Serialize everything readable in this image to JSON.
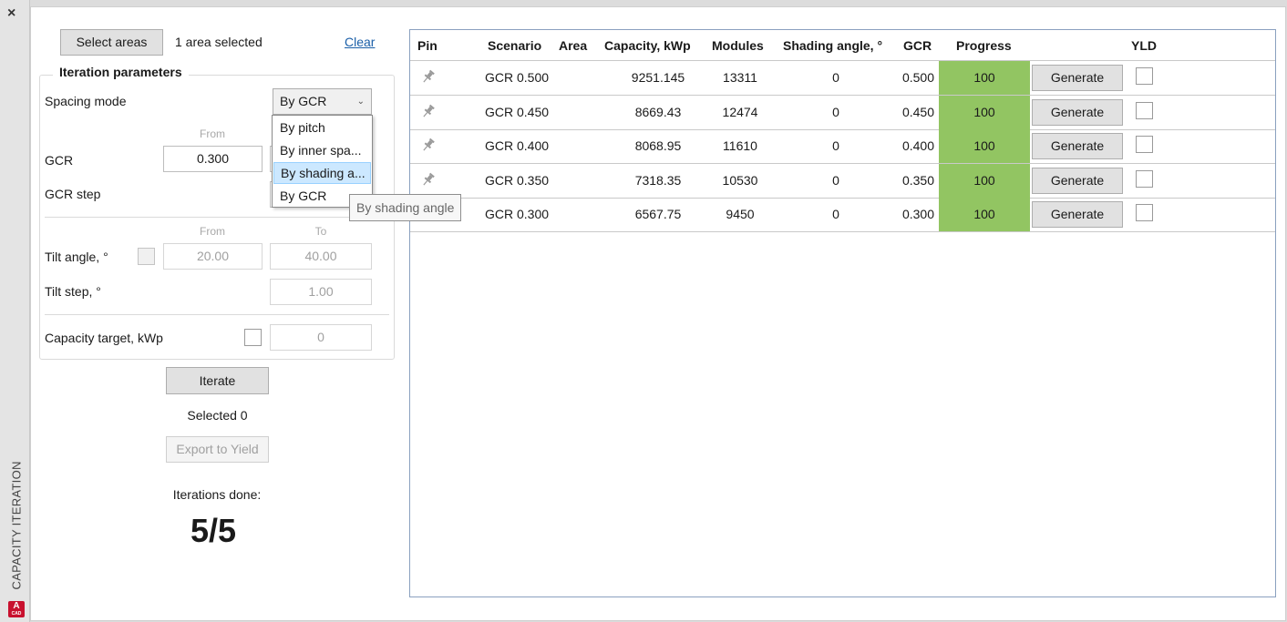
{
  "panel": {
    "side_title": "CAPACITY ITERATION",
    "close_glyph": "×",
    "app_logo_letter": "A",
    "app_logo_sub": "CAD"
  },
  "left": {
    "select_areas": "Select areas",
    "area_status": "1 area selected",
    "clear": "Clear",
    "group_title": "Iteration parameters",
    "spacing_mode_label": "Spacing mode",
    "spacing_mode_value": "By GCR",
    "dropdown_options": [
      "By pitch",
      "By inner spa...",
      "By shading a...",
      "By GCR"
    ],
    "dropdown_highlighted_index": 2,
    "tooltip": "By shading angle",
    "from_label": "From",
    "to_label": "To",
    "gcr_label": "GCR",
    "gcr_from": "0.300",
    "gcr_step_label": "GCR step",
    "tilt_label": "Tilt angle, °",
    "tilt_from": "20.00",
    "tilt_to": "40.00",
    "tilt_step_label": "Tilt step, °",
    "tilt_step": "1.00",
    "capacity_label": "Capacity target, kWp",
    "capacity_value": "0",
    "iterate": "Iterate",
    "selected": "Selected 0",
    "export": "Export to Yield",
    "iterations_label": "Iterations done:",
    "iterations_value": "5/5"
  },
  "table": {
    "headers": {
      "pin": "Pin",
      "scenario": "Scenario",
      "area": "Area",
      "capacity": "Capacity, kWp",
      "modules": "Modules",
      "shading": "Shading angle, °",
      "gcr": "GCR",
      "progress": "Progress",
      "yld": "YLD"
    },
    "generate_label": "Generate",
    "rows": [
      {
        "scenario": "GCR 0.500",
        "area": "",
        "capacity": "9251.145",
        "modules": "13311",
        "shading": "0",
        "gcr": "0.500",
        "progress": "100"
      },
      {
        "scenario": "GCR 0.450",
        "area": "",
        "capacity": "8669.43",
        "modules": "12474",
        "shading": "0",
        "gcr": "0.450",
        "progress": "100"
      },
      {
        "scenario": "GCR 0.400",
        "area": "",
        "capacity": "8068.95",
        "modules": "11610",
        "shading": "0",
        "gcr": "0.400",
        "progress": "100"
      },
      {
        "scenario": "GCR 0.350",
        "area": "",
        "capacity": "7318.35",
        "modules": "10530",
        "shading": "0",
        "gcr": "0.350",
        "progress": "100"
      },
      {
        "scenario": "GCR 0.300",
        "area": "",
        "capacity": "6567.75",
        "modules": "9450",
        "shading": "0",
        "gcr": "0.300",
        "progress": "100"
      }
    ]
  },
  "colors": {
    "progress_fill": "#92c562",
    "dropdown_highlight": "#cce8ff",
    "link": "#1a5fa8",
    "table_border": "#8aa0bf"
  },
  "icons": {
    "pin": "pin-icon",
    "close": "close-icon",
    "chevron": "chevron-down-icon"
  }
}
